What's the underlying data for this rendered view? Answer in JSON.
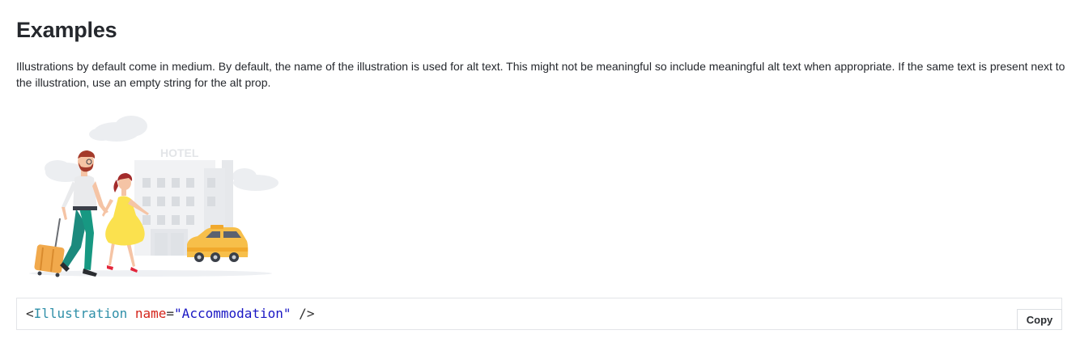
{
  "section": {
    "title": "Examples",
    "description": "Illustrations by default come in medium. By default, the name of the illustration is used for alt text. This might not be meaningful so include meaningful alt text when appropriate. If the same text is present next to the illustration, use an empty string for the alt prop."
  },
  "illustration": {
    "name": "Accommodation",
    "sign_text": "HOTEL"
  },
  "code": {
    "open": "<",
    "component": "Illustration",
    "space": " ",
    "attr_name": "name",
    "equals": "=",
    "attr_value": "\"Accommodation\"",
    "close": " />"
  },
  "copy_button": {
    "label": "Copy"
  }
}
